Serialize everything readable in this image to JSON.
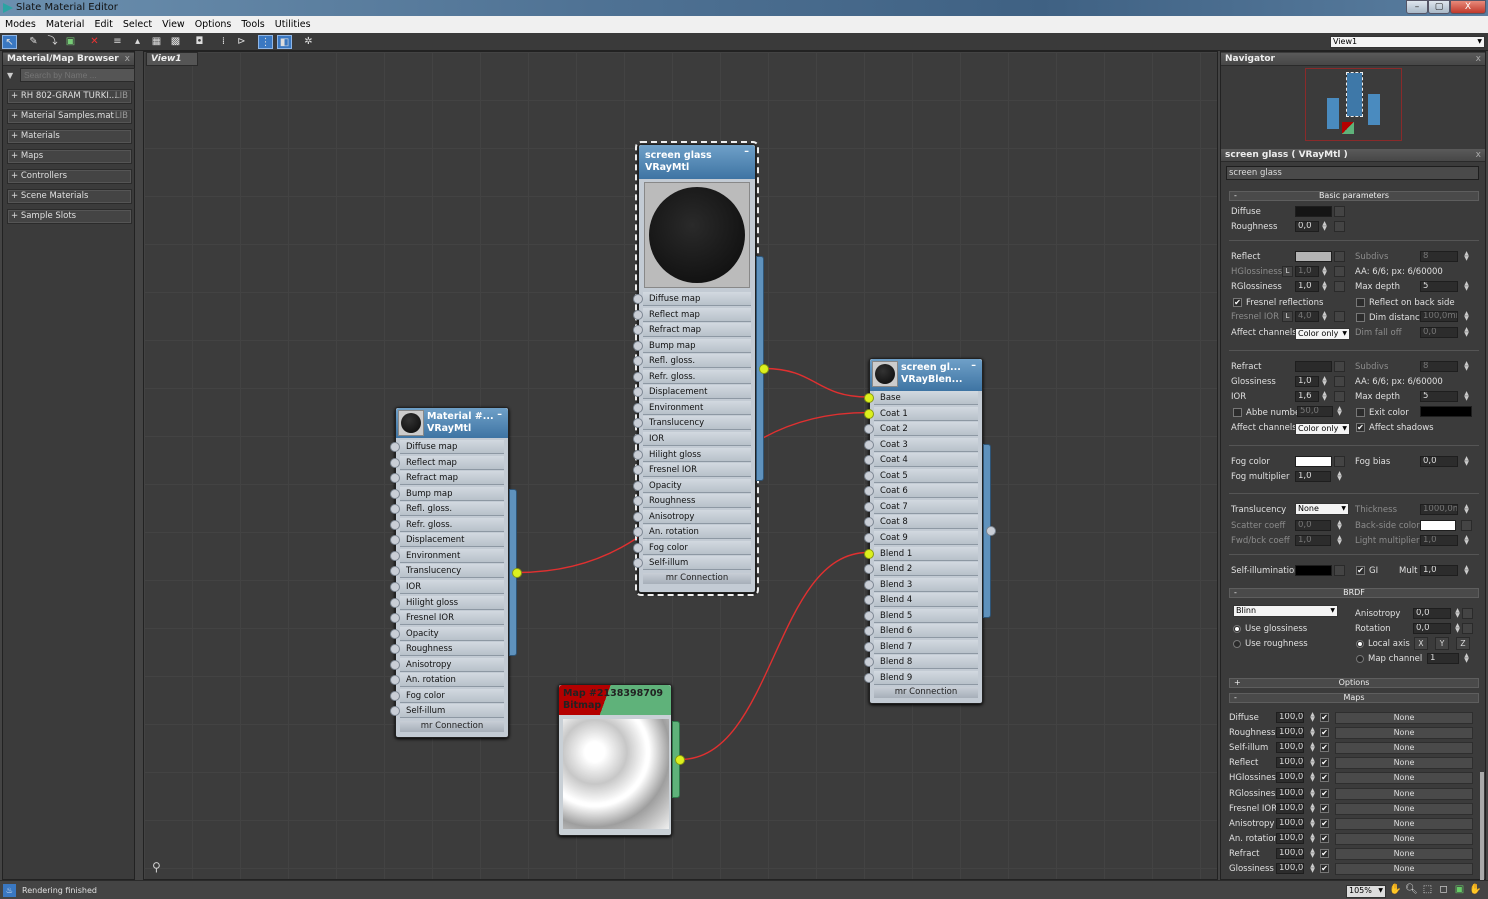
{
  "window": {
    "title": "Slate Material Editor",
    "minimize": "–",
    "maximize": "▢",
    "close": "X"
  },
  "menu": [
    "Modes",
    "Material",
    "Edit",
    "Select",
    "View",
    "Options",
    "Tools",
    "Utilities"
  ],
  "toolbar": {
    "icons": [
      "select-icon",
      "pick-material-icon",
      "put-to-scene-icon",
      "assign-material-icon",
      "delete-icon",
      "move-children-icon",
      "hide-unused-icon",
      "show-map-icon",
      "show-background-icon",
      "layout-all-icon",
      "layout-children-icon",
      "show-children-icon",
      "material-map-node-icon",
      "render-icon"
    ],
    "view_select": "View1"
  },
  "browser": {
    "title": "Material/Map Browser",
    "close": "x",
    "search_placeholder": "Search by Name ...",
    "items": [
      {
        "label": "+ RH 802-GRAM TURKI...",
        "tag": "LIB"
      },
      {
        "label": "+ Material Samples.mat",
        "tag": "LIB"
      },
      {
        "label": "+ Materials"
      },
      {
        "label": "+ Maps"
      },
      {
        "label": "+ Controllers"
      },
      {
        "label": "+ Scene Materials"
      },
      {
        "label": "+ Sample Slots"
      }
    ]
  },
  "canvas": {
    "tab": "View1",
    "nodes": [
      {
        "id": "glass",
        "title": "screen glass",
        "type": "VRayMtl",
        "selected": true,
        "inputs": [
          "Diffuse map",
          "Reflect map",
          "Refract map",
          "Bump map",
          "Refl. gloss.",
          "Refr. gloss.",
          "Displacement",
          "Environment",
          "Translucency",
          "IOR",
          "Hilight gloss",
          "Fresnel IOR",
          "Opacity",
          "Roughness",
          "Anisotropy",
          "An. rotation",
          "Fog color",
          "Self-illum"
        ],
        "footer": "mr Connection",
        "connected_out": true
      },
      {
        "id": "mat",
        "title": "Material #...",
        "type": "VRayMtl",
        "inputs": [
          "Diffuse map",
          "Reflect map",
          "Refract map",
          "Bump map",
          "Refl. gloss.",
          "Refr. gloss.",
          "Displacement",
          "Environment",
          "Translucency",
          "IOR",
          "Hilight gloss",
          "Fresnel IOR",
          "Opacity",
          "Roughness",
          "Anisotropy",
          "An. rotation",
          "Fog color",
          "Self-illum"
        ],
        "footer": "mr Connection",
        "connected_out": true
      },
      {
        "id": "blend",
        "title": "screen gl...",
        "type": "VRayBlen...",
        "inputs": [
          "Base",
          "Coat 1",
          "Coat 2",
          "Coat 3",
          "Coat 4",
          "Coat 5",
          "Coat 6",
          "Coat 7",
          "Coat 8",
          "Coat 9",
          "Blend 1",
          "Blend 2",
          "Blend 3",
          "Blend 4",
          "Blend 5",
          "Blend 6",
          "Blend 7",
          "Blend 8",
          "Blend 9"
        ],
        "connected_in": [
          "Base",
          "Coat 1",
          "Blend 1"
        ],
        "footer": "mr Connection"
      },
      {
        "id": "bitmap",
        "title": "Map #2138398709",
        "type": "Bitmap",
        "connected_out": true
      }
    ],
    "wires": [
      {
        "from": "glass",
        "to": "Base"
      },
      {
        "from": "mat",
        "to": "Coat 1"
      },
      {
        "from": "bitmap",
        "to": "Blend 1"
      }
    ],
    "wire_color": "#e03030",
    "socket_on_color": "#dcf01e"
  },
  "navigator": {
    "title": "Navigator",
    "close": "x"
  },
  "props": {
    "title": "screen glass  ( VRayMtl )",
    "close": "x",
    "name": "screen glass",
    "basic": {
      "header": "Basic parameters",
      "collapse": "-",
      "diffuse": "Diffuse",
      "roughness": "Roughness",
      "roughness_val": "0,0",
      "reflect": "Reflect",
      "subdivs": "Subdivs",
      "subdivs_val": "8",
      "hgloss": "HGlossiness",
      "hgloss_val": "1,0",
      "lock": "L",
      "aa": "AA: 6/6; px: 6/60000",
      "rgloss": "RGlossiness",
      "rgloss_val": "1,0",
      "maxdepth": "Max depth",
      "maxdepth_val": "5",
      "fresnel": "Fresnel reflections",
      "backside": "Reflect on back side",
      "fresnel_ior": "Fresnel IOR",
      "fresnel_ior_val": "4,0",
      "dimdist": "Dim distance",
      "dimdist_val": "100,0mm",
      "affect": "Affect channels",
      "affect_val": "Color only",
      "dimfall": "Dim fall off",
      "dimfall_val": "0,0",
      "refract": "Refract",
      "r_subdivs_val": "8",
      "gloss": "Glossiness",
      "gloss_val": "1,0",
      "ior": "IOR",
      "ior_val": "1,6",
      "r_maxdepth_val": "5",
      "abbe": "Abbe number",
      "abbe_val": "50,0",
      "exitcolor": "Exit color",
      "affect_shadows": "Affect shadows",
      "fogcolor": "Fog color",
      "fogbias": "Fog bias",
      "fogbias_val": "0,0",
      "fogmult": "Fog multiplier",
      "fogmult_val": "1,0",
      "transl": "Translucency",
      "transl_val": "None",
      "thick": "Thickness",
      "thick_val": "1000,0mm",
      "scatter": "Scatter coeff",
      "scatter_val": "0,0",
      "backcolor": "Back-side color",
      "fwd": "Fwd/bck coeff",
      "fwd_val": "1,0",
      "lightmult": "Light multiplier",
      "lightmult_val": "1,0",
      "selfillum": "Self-illumination",
      "gi": "GI",
      "mult": "Mult",
      "mult_val": "1,0"
    },
    "brdf": {
      "header": "BRDF",
      "collapse": "-",
      "type": "Blinn",
      "aniso": "Anisotropy",
      "aniso_val": "0,0",
      "rotation": "Rotation",
      "rotation_val": "0,0",
      "useg": "Use glossiness",
      "user": "Use roughness",
      "local": "Local axis",
      "x": "X",
      "y": "Y",
      "z": "Z",
      "mapch": "Map channel",
      "mapch_val": "1"
    },
    "options": {
      "header": "Options",
      "expand": "+"
    },
    "maps": {
      "header": "Maps",
      "collapse": "-",
      "rows": [
        {
          "name": "Diffuse",
          "amount": "100,0",
          "map": "None"
        },
        {
          "name": "Roughness",
          "amount": "100,0",
          "map": "None"
        },
        {
          "name": "Self-illum",
          "amount": "100,0",
          "map": "None"
        },
        {
          "name": "Reflect",
          "amount": "100,0",
          "map": "None"
        },
        {
          "name": "HGlossiness",
          "amount": "100,0",
          "map": "None"
        },
        {
          "name": "RGlossiness",
          "amount": "100,0",
          "map": "None"
        },
        {
          "name": "Fresnel IOR",
          "amount": "100,0",
          "map": "None"
        },
        {
          "name": "Anisotropy",
          "amount": "100,0",
          "map": "None"
        },
        {
          "name": "An. rotation",
          "amount": "100,0",
          "map": "None"
        },
        {
          "name": "Refract",
          "amount": "100,0",
          "map": "None"
        },
        {
          "name": "Glossiness",
          "amount": "100,0",
          "map": "None"
        }
      ]
    }
  },
  "status": {
    "text": "Rendering finished",
    "zoom": "105%"
  },
  "colors": {
    "diffuse": "#151515",
    "reflect": "#b4b4b4",
    "refract": "#2a2a2a",
    "exit": "#000000",
    "fog": "#ffffff",
    "backside": "#ffffff",
    "selfillum": "#000000",
    "node_header": "#4f86b5",
    "bitmap_red": "#b40000",
    "bitmap_green": "#5fb27a"
  }
}
